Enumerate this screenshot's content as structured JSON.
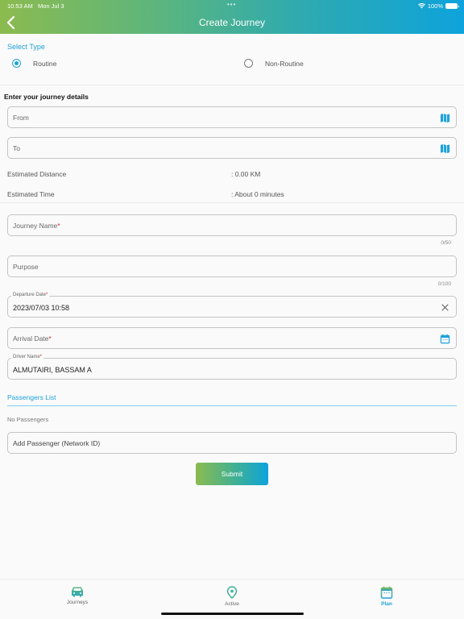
{
  "status_bar": {
    "time": "10:53 AM",
    "date": "Mon Jul 3",
    "dots": "•••",
    "battery": "100%"
  },
  "header": {
    "title": "Create Journey"
  },
  "select_type": {
    "label": "Select Type",
    "options": [
      {
        "label": "Routine",
        "selected": true
      },
      {
        "label": "Non-Routine",
        "selected": false
      }
    ]
  },
  "details": {
    "heading": "Enter your journey details",
    "from_placeholder": "From",
    "to_placeholder": "To",
    "estimated_distance_label": "Estimated Distance",
    "estimated_distance_value": ":  0.00 KM",
    "estimated_time_label": "Estimated Time",
    "estimated_time_value": ":  About 0 minutes"
  },
  "form": {
    "journey_name_label": "Journey Name",
    "journey_name_counter": "0/50",
    "purpose_label": "Purpose",
    "purpose_counter": "0/100",
    "departure_label": "Departure Date",
    "departure_value": "2023/07/03 10:58",
    "arrival_label": "Arrival Date",
    "driver_label": "Driver Name",
    "driver_value": "ALMUTAIRI, BASSAM A",
    "required_mark": "*"
  },
  "passengers": {
    "label": "Passengers List",
    "empty_text": "No Passengers",
    "add_placeholder": "Add Passenger (Network ID)"
  },
  "submit_label": "Submit",
  "tabs": [
    {
      "label": "Journeys",
      "icon": "car-icon",
      "active": false
    },
    {
      "label": "Active",
      "icon": "location-pin-icon",
      "active": false
    },
    {
      "label": "Plan",
      "icon": "calendar-icon",
      "active": true
    }
  ],
  "colors": {
    "accent": "#1ea2d9",
    "gradient_start": "#8bbb4f",
    "gradient_end": "#0ea3dc",
    "required": "#e02020"
  }
}
